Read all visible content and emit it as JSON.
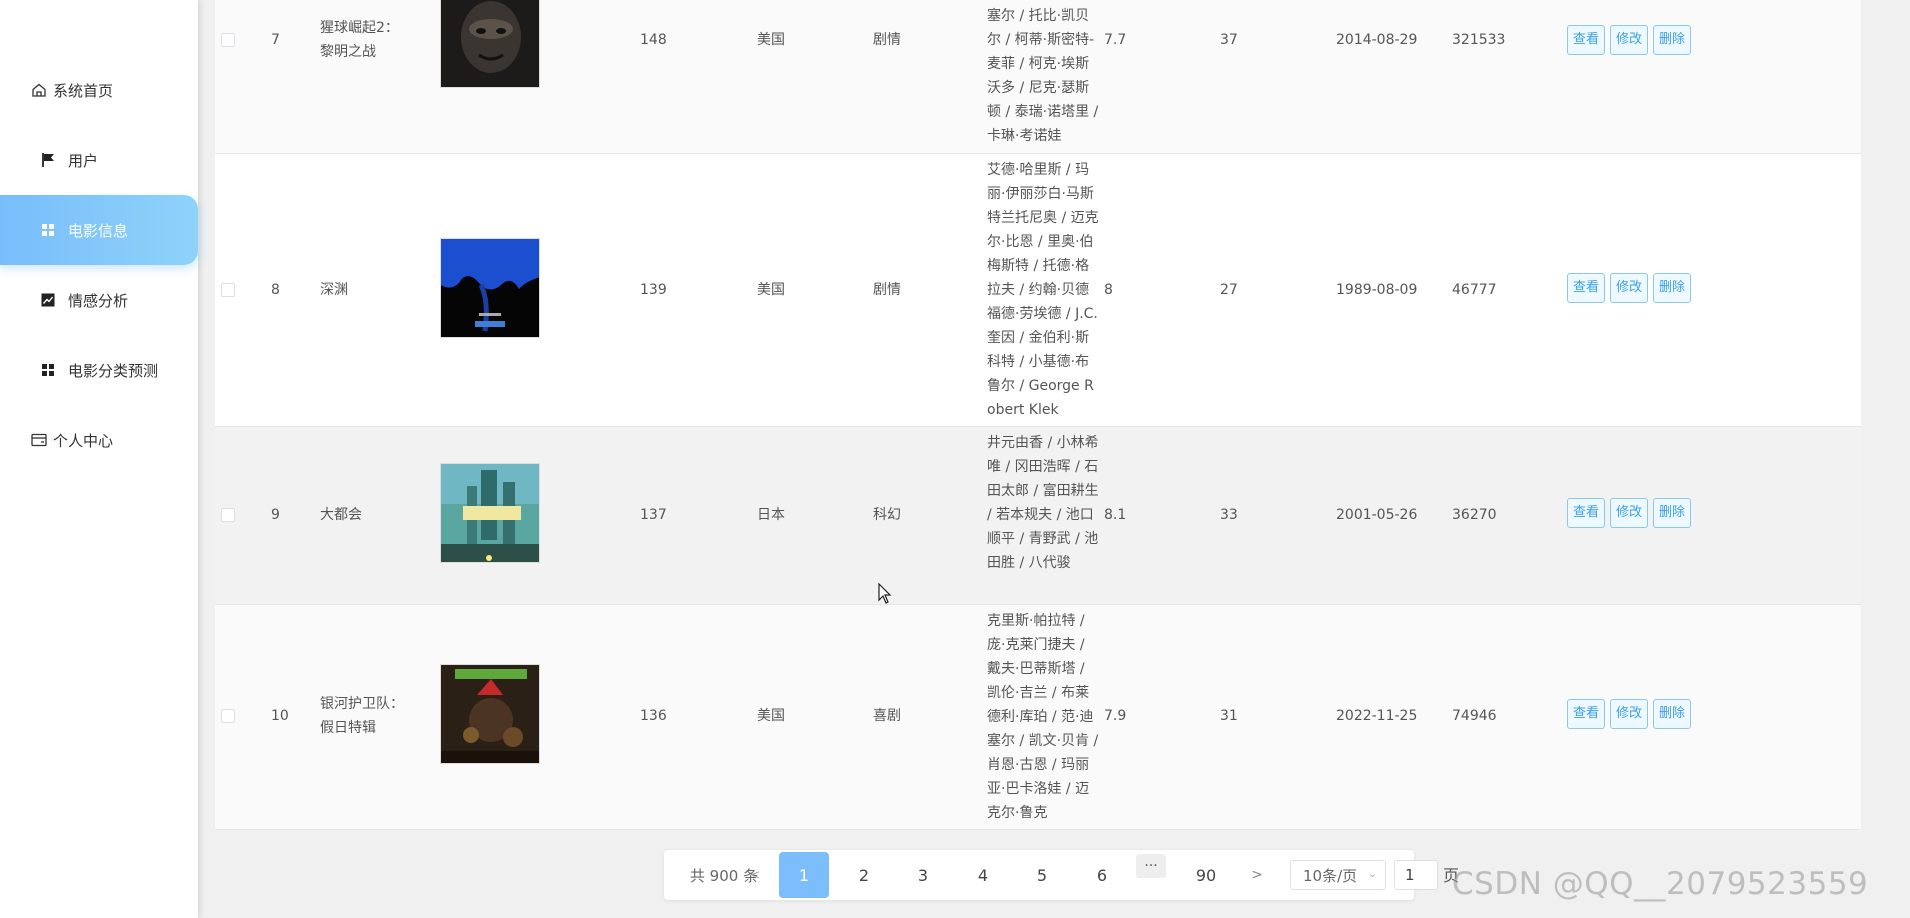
{
  "sidebar": {
    "items": [
      {
        "label": "系统首页",
        "icon": "home-icon"
      },
      {
        "label": "用户",
        "icon": "flag-icon"
      },
      {
        "label": "电影信息",
        "icon": "grid-icon"
      },
      {
        "label": "情感分析",
        "icon": "chart-icon"
      },
      {
        "label": "电影分类预测",
        "icon": "grid-icon"
      },
      {
        "label": "个人中心",
        "icon": "card-icon"
      }
    ],
    "active_color": "#79bdfb"
  },
  "table": {
    "rows": [
      {
        "index": "7",
        "title": "猩球崛起2：黎明之战",
        "duration": "148",
        "country": "美国",
        "genre": "剧情",
        "actors": "塞尔 / 托比·凯贝尔 / 柯蒂·斯密特-麦菲 / 柯克·埃斯沃多 / 尼克·瑟斯顿 / 泰瑞·诺塔里 / 卡琳·考诺娃",
        "rating": "7.7",
        "count": "37",
        "date": "2014-08-29",
        "votes": "321533",
        "poster_color": "#2a2622"
      },
      {
        "index": "8",
        "title": "深渊",
        "duration": "139",
        "country": "美国",
        "genre": "剧情",
        "actors": "艾德·哈里斯 / 玛丽·伊丽莎白·马斯特兰托尼奥 / 迈克尔·比恩 / 里奥·伯梅斯特 / 托德·格拉夫 / 约翰·贝德福德·劳埃德 / J.C.奎因 / 金伯利·斯科特 / 小基德·布鲁尔 / George Robert Klek",
        "rating": "8",
        "count": "27",
        "date": "1989-08-09",
        "votes": "46777",
        "poster_color": "#0a1a4a"
      },
      {
        "index": "9",
        "title": "大都会",
        "duration": "137",
        "country": "日本",
        "genre": "科幻",
        "actors": "井元由香 / 小林希唯 / 冈田浩晖 / 石田太郎 / 富田耕生 / 若本规夫 / 池口顺平 / 青野武 / 池田胜 / 八代骏",
        "rating": "8.1",
        "count": "33",
        "date": "2001-05-26",
        "votes": "36270",
        "poster_color": "#3d8a7a"
      },
      {
        "index": "10",
        "title": "银河护卫队：假日特辑",
        "duration": "136",
        "country": "美国",
        "genre": "喜剧",
        "actors": "克里斯·帕拉特 / 庞·克莱门捷夫 / 戴夫·巴蒂斯塔 / 凯伦·吉兰 / 布莱德利·库珀 / 范·迪塞尔 / 凯文·贝肯 / 肖恩·古恩 / 玛丽亚·巴卡洛娃 / 迈克尔·鲁克",
        "rating": "7.9",
        "count": "31",
        "date": "2022-11-25",
        "votes": "74946",
        "poster_color": "#3a2a1a"
      }
    ],
    "actions": {
      "view": "查看",
      "edit": "修改",
      "delete": "删除"
    }
  },
  "pagination": {
    "total_label": "共 900 条",
    "prev": "<",
    "pages": [
      "1",
      "2",
      "3",
      "4",
      "5",
      "6"
    ],
    "ellipsis": "···",
    "last_page": "90",
    "next": ">",
    "page_size": "10条/页",
    "jump_value": "1",
    "page_unit": "页",
    "active_color": "#7cbdfb"
  },
  "watermark": "CSDN @QQ__2079523559"
}
